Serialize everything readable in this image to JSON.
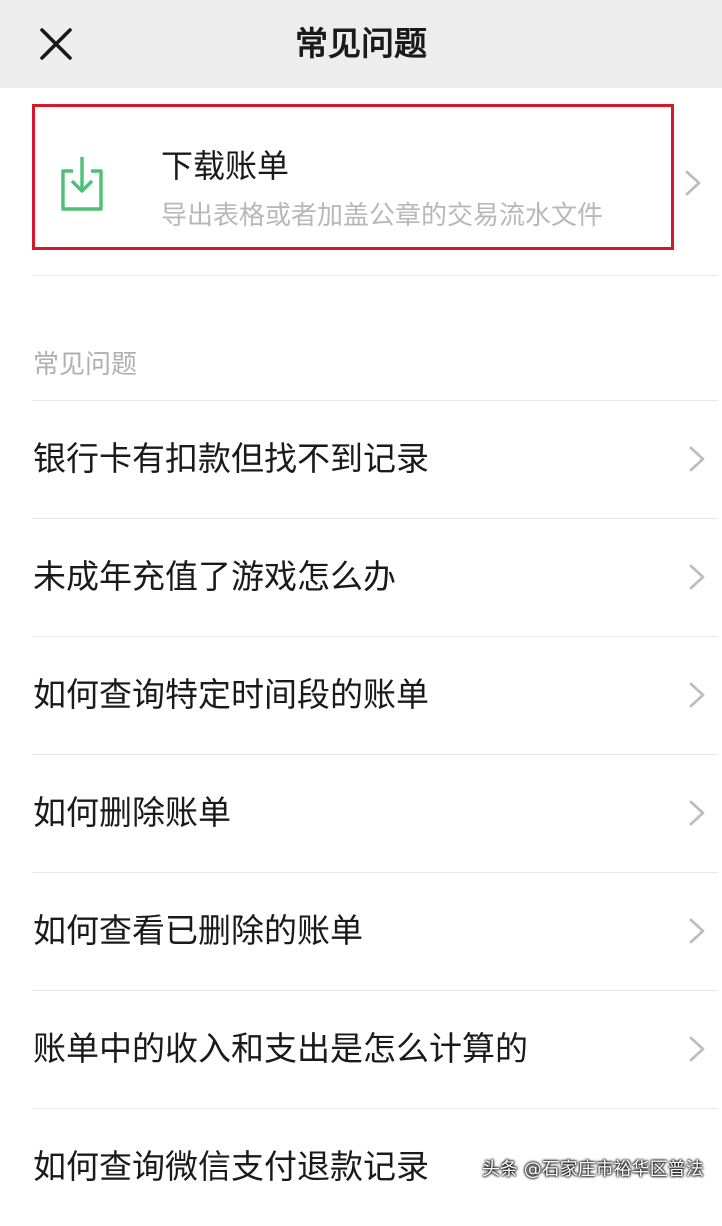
{
  "header": {
    "title": "常见问题",
    "close_icon": "close-icon"
  },
  "download": {
    "title": "下载账单",
    "subtitle": "导出表格或者加盖公章的交易流水文件",
    "icon": "download-icon",
    "icon_color": "#4cc074",
    "highlight_color": "#d8182a"
  },
  "section": {
    "label": "常见问题"
  },
  "faq": [
    "银行卡有扣款但找不到记录",
    "未成年充值了游戏怎么办",
    "如何查询特定时间段的账单",
    "如何删除账单",
    "如何查看已删除的账单",
    "账单中的收入和支出是怎么计算的",
    "如何查询微信支付退款记录"
  ],
  "watermark": "头条 @石家庄市裕华区普法"
}
